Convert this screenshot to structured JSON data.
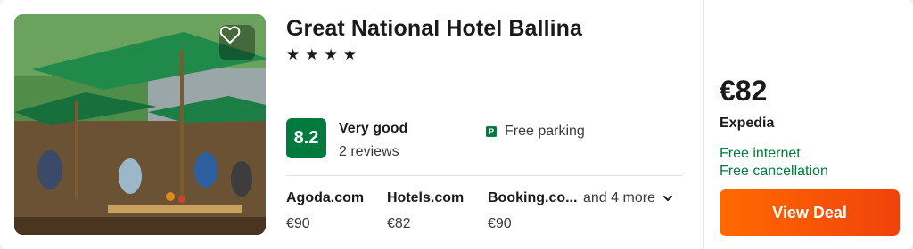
{
  "hotel": {
    "name": "Great National Hotel Ballina",
    "stars": 4,
    "star_glyph": "★"
  },
  "rating": {
    "score": "8.2",
    "label": "Very good",
    "reviews": "2 reviews"
  },
  "amenity": {
    "icon_letter": "P",
    "label": "Free parking"
  },
  "providers": [
    {
      "name": "Agoda.com",
      "price": "€90"
    },
    {
      "name": "Hotels.com",
      "price": "€82"
    },
    {
      "name": "Booking.co...",
      "price": "€90"
    }
  ],
  "more_providers": "and 4 more",
  "deal": {
    "price": "€82",
    "vendor": "Expedia",
    "perks": [
      "Free internet",
      "Free cancellation"
    ],
    "button_label": "View Deal"
  },
  "colors": {
    "accent_green": "#007a3d",
    "button_orange": "#ff6a00"
  },
  "icons": {
    "favorite": "heart-icon",
    "more": "chevron-down-icon",
    "parking": "parking-icon"
  }
}
